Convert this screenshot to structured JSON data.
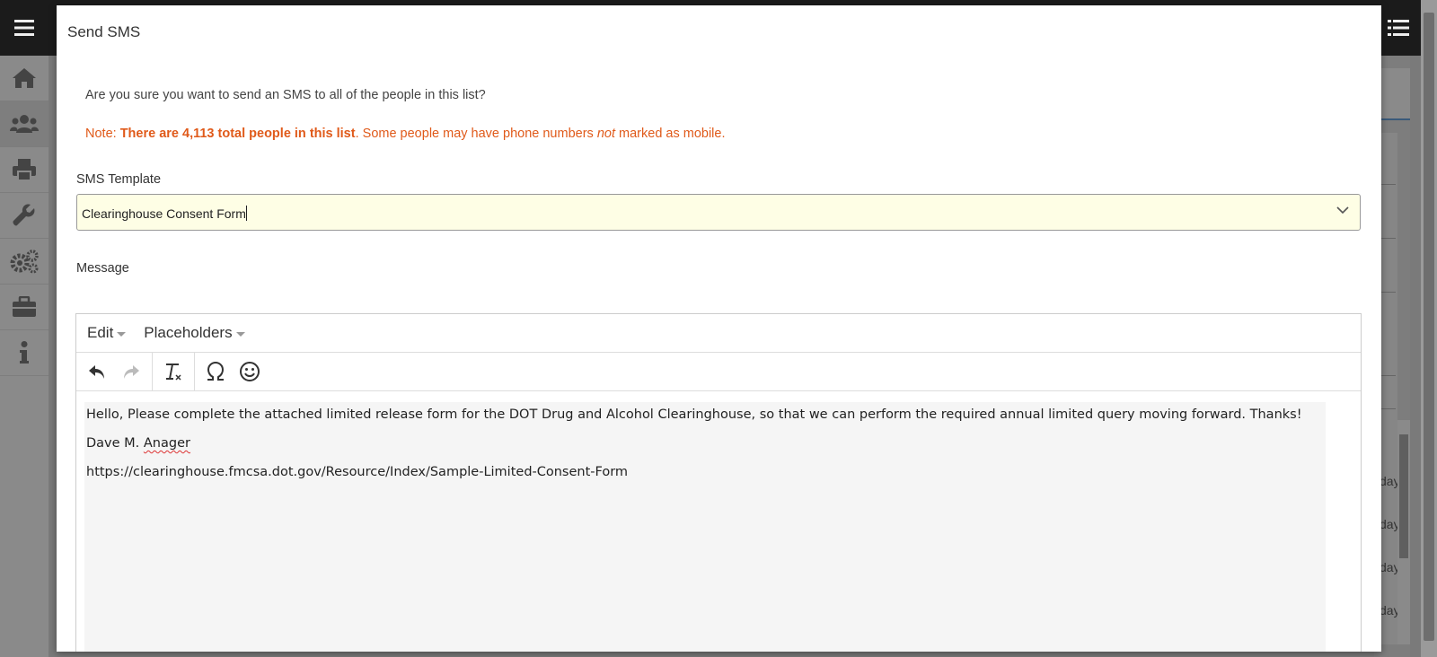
{
  "background": {
    "sidebar_icons": [
      "home-icon",
      "users-icon",
      "print-icon",
      "wrench-icon",
      "settings-icon",
      "briefcase-icon",
      "info-icon"
    ],
    "day_fragments": [
      "day",
      "day",
      "day",
      "day"
    ]
  },
  "modal": {
    "title": "Send SMS",
    "confirm_text": "Are you sure you want to send an SMS to all of the people in this list?",
    "note": {
      "prefix": "Note: ",
      "bold": "There are 4,113 total people in this list",
      "middle": ". Some people may have phone numbers ",
      "italic": "not",
      "suffix": " marked as mobile."
    },
    "template_label": "SMS Template",
    "template_value": "Clearinghouse Consent Form",
    "message_label": "Message",
    "editor": {
      "menus": [
        "Edit",
        "Placeholders"
      ],
      "toolbar": [
        "undo-icon",
        "redo-icon",
        "clear-format-icon",
        "special-char-icon",
        "emoji-icon"
      ],
      "lines": {
        "line1": "Hello, Please complete the attached limited release form for the DOT Drug and Alcohol Clearinghouse, so that we can perform the required annual limited query moving forward. Thanks!",
        "line2_first": "Dave M. ",
        "line2_last": "Anager",
        "line3": "https://clearinghouse.fmcsa.dot.gov/Resource/Index/Sample-Limited-Consent-Form"
      }
    }
  },
  "colors": {
    "note": "#e05a1a",
    "select_bg": "#fefee5",
    "topbar": "#1b1b1b"
  }
}
